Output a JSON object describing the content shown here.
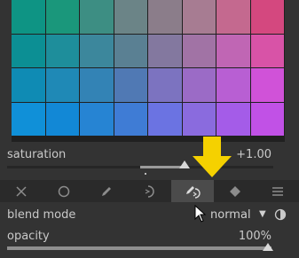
{
  "saturation": {
    "label": "saturation",
    "value": "+1.00",
    "level": 0.66
  },
  "tabs": [
    {
      "name": "tab-off",
      "icon": "close-icon",
      "active": false
    },
    {
      "name": "tab-uniformly",
      "icon": "circle-icon",
      "active": false
    },
    {
      "name": "tab-drawn-mask",
      "icon": "pencil-icon",
      "active": false
    },
    {
      "name": "tab-parametric-mask",
      "icon": "parametric-icon",
      "active": false
    },
    {
      "name": "tab-drawn-parametric-mask",
      "icon": "pencil-parametric-icon",
      "active": true
    },
    {
      "name": "tab-raster-mask",
      "icon": "raster-icon",
      "active": false
    },
    {
      "name": "tab-menu",
      "icon": "menu-icon",
      "active": false
    }
  ],
  "blend": {
    "label": "blend mode",
    "value": "normal",
    "caret": "▼"
  },
  "opacity": {
    "label": "opacity",
    "value": "100%",
    "level": 1.0
  },
  "colors": {
    "grid": [
      [
        "#0e9484",
        "#1a977b",
        "#3d8e83",
        "#6b8487",
        "#8b7d8a",
        "#a77c92",
        "#c4698f",
        "#d4487f"
      ],
      [
        "#0c8f94",
        "#1e8e9b",
        "#3c879c",
        "#5a8093",
        "#83789f",
        "#a173a5",
        "#c066b4",
        "#d853a7"
      ],
      [
        "#0f8bb4",
        "#1f89b6",
        "#3383b5",
        "#5079b4",
        "#7c73c0",
        "#9b6bc6",
        "#b85fd3",
        "#d052d8"
      ],
      [
        "#1090d8",
        "#1288d6",
        "#2684d3",
        "#3f7cd5",
        "#6b73e2",
        "#8a6bde",
        "#a45ce8",
        "#c151e6"
      ]
    ],
    "accent": "#f5d100"
  }
}
